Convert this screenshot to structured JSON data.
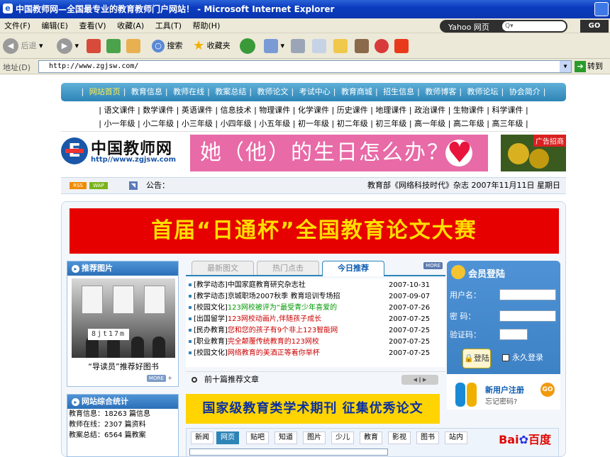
{
  "window": {
    "title": "中国教师网—全国最专业的教育教师门户网站！ - Microsoft Internet Explorer"
  },
  "menu": [
    "文件(F)",
    "编辑(E)",
    "查看(V)",
    "收藏(A)",
    "工具(T)",
    "帮助(H)"
  ],
  "yahoo": {
    "label": "Yahoo 网页",
    "go": "GO"
  },
  "toolbar": {
    "back": "后退",
    "search": "搜索",
    "favorites": "收藏夹"
  },
  "address": {
    "label": "地址(D)",
    "url": "http://www.zgjsw.com/",
    "go": "转到"
  },
  "nav1": [
    "网站首页",
    "教育信息",
    "教师在线",
    "教案总结",
    "教师论文",
    "考试中心",
    "教育商城",
    "招生信息",
    "教师博客",
    "教师论坛",
    "协会简介"
  ],
  "nav2_row1": [
    "语文课件",
    "数学课件",
    "英语课件",
    "信息技术",
    "物理课件",
    "化学课件",
    "历史课件",
    "地理课件",
    "政治课件",
    "生物课件",
    "科学课件"
  ],
  "nav2_row2": [
    "小一年级",
    "小二年级",
    "小三年级",
    "小四年级",
    "小五年级",
    "初一年级",
    "初二年级",
    "初三年级",
    "高一年级",
    "高二年级",
    "高三年级"
  ],
  "logo": {
    "name": "中国教师网",
    "url": "http//www.zgjsw.com"
  },
  "banner": {
    "text": "她（他）的生日怎么办？"
  },
  "ad": {
    "label": "广告招商"
  },
  "announce": {
    "rss": "RSS",
    "wap": "WAP",
    "label": "公告：",
    "right": "教育部《网络科技时代》杂志  2007年11月11日 星期日"
  },
  "contest": {
    "text": "首届“日通杯”全国教育论文大赛"
  },
  "photos": {
    "title": "推荐图片",
    "caption": "“导读员”推荐好图书",
    "more": "MORE"
  },
  "tabs": {
    "items": [
      "最新图文",
      "热门点击",
      "今日推荐"
    ],
    "more": "MORE"
  },
  "news": [
    {
      "tag": "[教学动态]",
      "title": "中国家庭教育研究杂志社",
      "date": "2007-10-31",
      "color": "black"
    },
    {
      "tag": "[教学动态]",
      "title": "京城职场2007秋季 教育培训专场招",
      "date": "2007-09-07",
      "color": "black"
    },
    {
      "tag": "[校园文化]",
      "title": "123网校被评为“最受青少年喜爱的",
      "date": "2007-07-26",
      "color": "green"
    },
    {
      "tag": "[出国留学]",
      "title": "123网校动画片,伴随孩子成长",
      "date": "2007-07-25",
      "color": "red"
    },
    {
      "tag": "[民办教育]",
      "title": "您和您的孩子有9个非上123智能网",
      "date": "2007-07-25",
      "color": "red"
    },
    {
      "tag": "[职业教育]",
      "title": "完全颠覆传统教育的123网校",
      "date": "2007-07-25",
      "color": "red"
    },
    {
      "tag": "[校园文化]",
      "title": "网络教育的美酒正等着你举杯",
      "date": "2007-07-25",
      "color": "red"
    }
  ],
  "top10": {
    "label": "前十篇推荐文章"
  },
  "login": {
    "title": "会员登陆",
    "username": "用户名：",
    "password": "密  码：",
    "captcha": "验证码：",
    "code": "8jt17m",
    "submit": "登陆",
    "remember": "永久登录"
  },
  "register": {
    "title": "新用户注册",
    "forgot": "忘记密码?",
    "go": "GO"
  },
  "stats": {
    "title": "网站综合统计",
    "rows": [
      "教育信息：18263 篇信息",
      "教师在线：2307 篇资料",
      "教案总结：6564 篇教案"
    ]
  },
  "periodical": {
    "text": "国家级教育类学术期刊 征集优秀论文"
  },
  "baidu": {
    "tabs": [
      "新闻",
      "网页",
      "贴吧",
      "知道",
      "图片",
      "少儿",
      "教育",
      "影视",
      "图书",
      "站内"
    ],
    "logo1": "Bai",
    "logo2": "百度"
  }
}
